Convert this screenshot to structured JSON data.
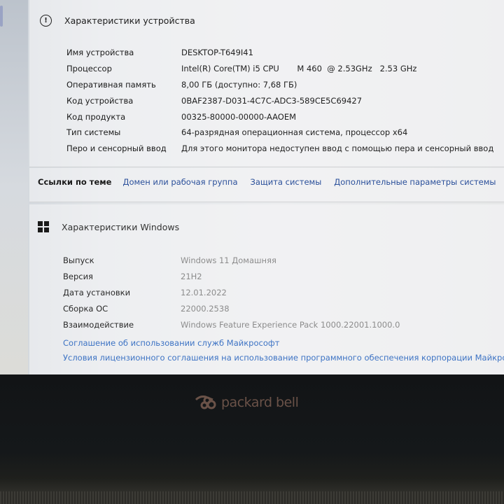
{
  "device_specs": {
    "title": "Характеристики устройства",
    "rows": [
      {
        "key": "Имя устройства",
        "value": "DESKTOP-T649I41"
      },
      {
        "key": "Процессор",
        "value": "Intel(R) Core(TM) i5 CPU       M 460  @ 2.53GHz   2.53 GHz"
      },
      {
        "key": "Оперативная память",
        "value": "8,00 ГБ (доступно: 7,68 ГБ)"
      },
      {
        "key": "Код устройства",
        "value": "0BAF2387-D031-4C7C-ADC3-589CE5C69427"
      },
      {
        "key": "Код продукта",
        "value": "00325-80000-00000-AAOEM"
      },
      {
        "key": "Тип системы",
        "value": "64-разрядная операционная система, процессор x64"
      },
      {
        "key": "Перо и сенсорный ввод",
        "value": "Для этого монитора недоступен ввод с помощью пера и сенсорный ввод"
      }
    ]
  },
  "related_links": {
    "label": "Ссылки по теме",
    "links": [
      "Домен или рабочая группа",
      "Защита системы",
      "Дополнительные параметры системы"
    ]
  },
  "windows_specs": {
    "title": "Характеристики Windows",
    "rows": [
      {
        "key": "Выпуск",
        "value": "Windows 11 Домашняя"
      },
      {
        "key": "Версия",
        "value": "21H2"
      },
      {
        "key": "Дата установки",
        "value": "12.01.2022"
      },
      {
        "key": "Сборка ОС",
        "value": "22000.2538"
      },
      {
        "key": "Взаимодействие",
        "value": "Windows Feature Experience Pack 1000.22001.1000.0"
      }
    ],
    "links": [
      "Соглашение об использовании служб Майкрософт",
      "Условия лицензионного соглашения на использование программного обеспечения корпорации Майкрософт"
    ]
  },
  "bezel": {
    "brand": "packard bell"
  },
  "colors": {
    "link": "#2a4f9a",
    "ms_link": "#3d73c4",
    "brand_logo": "#6a5248"
  }
}
